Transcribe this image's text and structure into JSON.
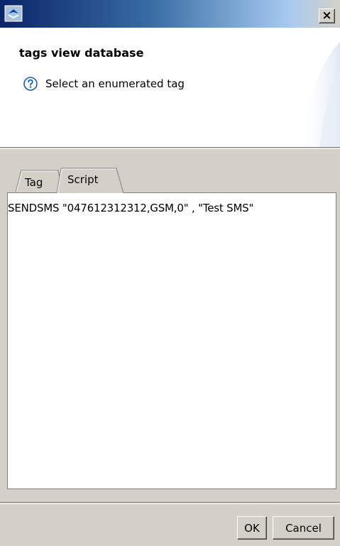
{
  "window": {
    "close_glyph": "×",
    "app_icon": "app-icon"
  },
  "header": {
    "title": "tags view database",
    "subtitle": "Select an enumerated tag",
    "help_icon": "help-icon"
  },
  "tabs": [
    {
      "label": "Tag",
      "selected": false
    },
    {
      "label": "Script",
      "selected": true
    }
  ],
  "editor": {
    "content": "SENDSMS \"047612312312,GSM,0\" , \"Test SMS\""
  },
  "buttons": {
    "ok_label": "OK",
    "cancel_label": "Cancel"
  },
  "colors": {
    "titlebar_start": "#0a246a",
    "titlebar_end": "#a6caf0",
    "face": "#d4d0c8",
    "help_blue": "#1e5cb3"
  }
}
